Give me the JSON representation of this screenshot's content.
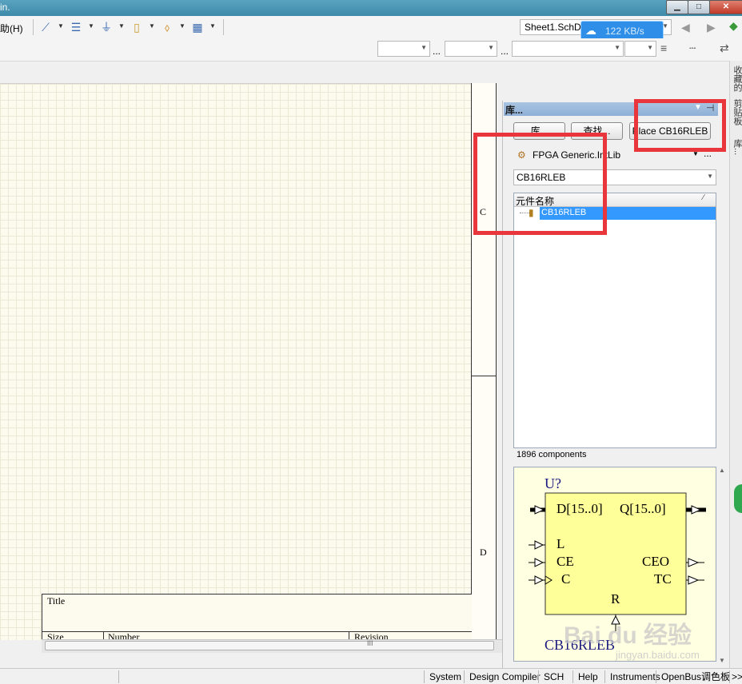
{
  "titlebar": {
    "title_fragment": "in.",
    "min": "▁",
    "max": "□",
    "close": "✕"
  },
  "menu": {
    "help_label": "助(H)"
  },
  "toolbar": {
    "icons": [
      "wire-icon",
      "bus-icon",
      "power-port-icon",
      "pin-icon",
      "port-icon",
      "grid-icon"
    ],
    "document_tab": "Sheet1.SchD",
    "network_speed": "122 KB/s",
    "ellipsis": "..."
  },
  "sheet": {
    "zone_c": "C",
    "zone_d": "D",
    "title_block": {
      "title": "Title",
      "size": "Size",
      "number": "Number",
      "revision": "Revision"
    },
    "hscroll_grip": "III"
  },
  "library_panel": {
    "header": "库...",
    "buttons": {
      "libraries": "库...",
      "search": "查找...",
      "place": "Place CB16RLEB"
    },
    "library_selected": "FPGA Generic.IntLib",
    "filter_value": "CB16RLEB",
    "list_header": "元件名称",
    "components": [
      "CB16RLEB"
    ],
    "component_count": "1896 components",
    "preview": {
      "designator": "U?",
      "part_name": "CB16RLEB",
      "pins_left": [
        "D[15..0]",
        "L",
        "CE",
        "C"
      ],
      "pins_right": [
        "Q[15..0]",
        "CEO",
        "TC"
      ],
      "pin_bottom": "R"
    }
  },
  "right_tabs": [
    "收藏的",
    "剪贴板",
    "库..."
  ],
  "statusbar": [
    "System",
    "Design Compiler",
    "SCH",
    "Help",
    "Instruments",
    "OpenBus调色板",
    ">>"
  ],
  "watermark": "Bai du 经验",
  "watermark_url": "jingyan.baidu.com",
  "colors": {
    "accent": "#3399ff",
    "highlight": "#e8363c",
    "sheet": "#fdfbed",
    "symbol_fill": "#ffff99",
    "symbol_text": "#1a1a80"
  }
}
